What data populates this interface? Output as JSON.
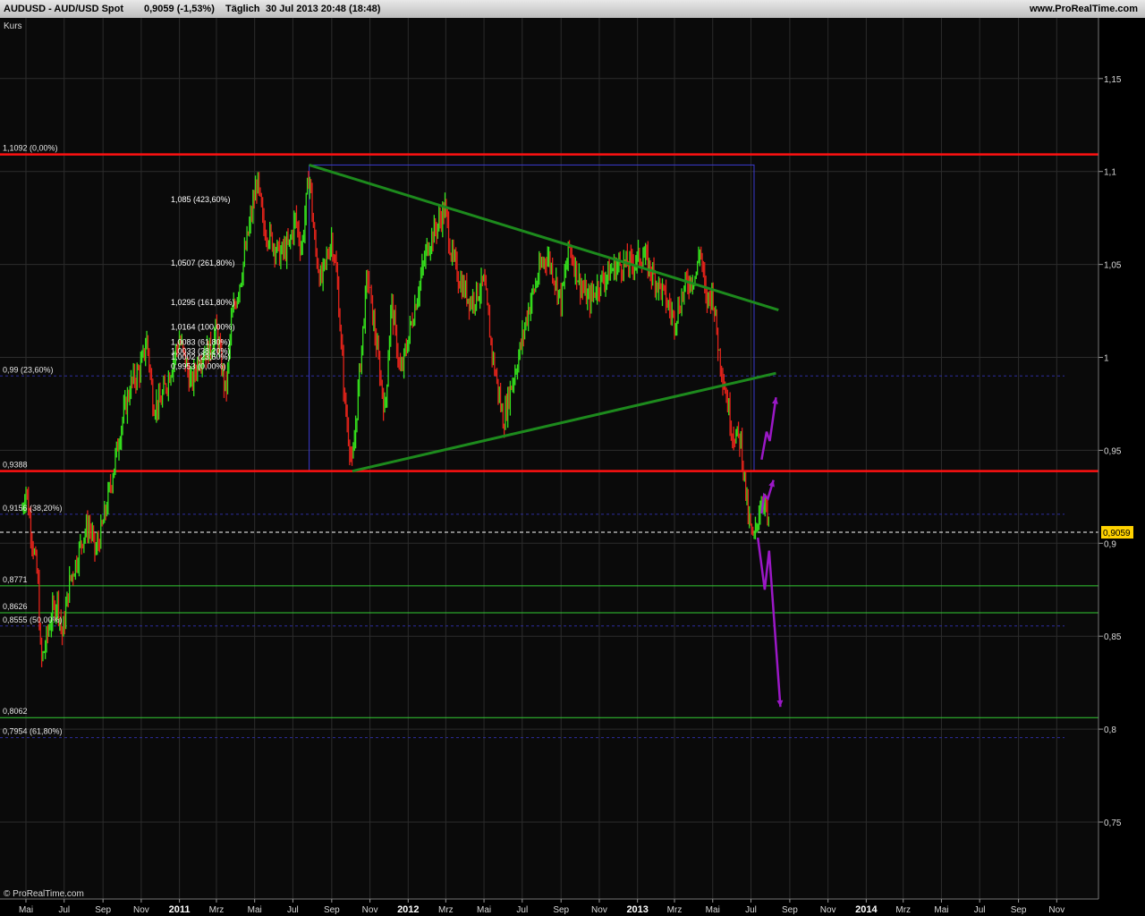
{
  "header": {
    "symbol": "AUDUSD - AUD/USD Spot",
    "quote": "0,9059 (-1,53%)",
    "period": "Täglich",
    "timestamp": "30 Jul 2013 20:48 (18:48)",
    "site": "www.ProRealTime.com"
  },
  "panel_label": "Kurs",
  "copyright": "© ProRealTime.com",
  "current_price_label": "0,9059",
  "colors": {
    "background": "#000000",
    "plot_bg": "#0a0a0a",
    "bull": "#34e01c",
    "bear": "#e2231a",
    "resistance": "#ff1111",
    "support_green": "#33cc33",
    "triangle": "#1d8a1d",
    "projection": "#9b18c6",
    "fib_blue": "#2d2d9f",
    "price_tag": "#ffd200"
  },
  "chart_data": {
    "type": "line",
    "title": "AUDUSD - AUD/USD Spot",
    "ylabel": "Kurs",
    "ylim": [
      0.7,
      1.19
    ],
    "grid": true,
    "x_tick_labels": [
      "Mai",
      "Jul",
      "Sep",
      "Nov",
      "2011",
      "Mrz",
      "Mai",
      "Jul",
      "Sep",
      "Nov",
      "2012",
      "Mrz",
      "Mai",
      "Jul",
      "Sep",
      "Nov",
      "2013",
      "Mrz",
      "Mai",
      "Jul",
      "Sep",
      "Nov",
      "2014",
      "Mrz",
      "Mai",
      "Jul",
      "Sep",
      "Nov"
    ],
    "x_tick_dates": [
      "2010-05",
      "2010-07",
      "2010-09",
      "2010-11",
      "2011-01",
      "2011-03",
      "2011-05",
      "2011-07",
      "2011-09",
      "2011-11",
      "2012-01",
      "2012-03",
      "2012-05",
      "2012-07",
      "2012-09",
      "2012-11",
      "2013-01",
      "2013-03",
      "2013-05",
      "2013-07",
      "2013-09",
      "2013-11",
      "2014-01",
      "2014-03",
      "2014-05",
      "2014-07",
      "2014-09",
      "2014-11"
    ],
    "y_ticks": [
      {
        "value": 1.15,
        "label": "1,15"
      },
      {
        "value": 1.1,
        "label": "1,1"
      },
      {
        "value": 1.05,
        "label": "1,05"
      },
      {
        "value": 1.0,
        "label": "1"
      },
      {
        "value": 0.95,
        "label": "0,95"
      },
      {
        "value": 0.9,
        "label": "0,9"
      },
      {
        "value": 0.85,
        "label": "0,85"
      },
      {
        "value": 0.8,
        "label": "0,8"
      },
      {
        "value": 0.75,
        "label": "0,75"
      }
    ],
    "price_path": [
      [
        "2010-04-25",
        0.918
      ],
      [
        "2010-05-01",
        0.93
      ],
      [
        "2010-05-10",
        0.905
      ],
      [
        "2010-05-20",
        0.88
      ],
      [
        "2010-05-25",
        0.835
      ],
      [
        "2010-06-01",
        0.845
      ],
      [
        "2010-06-10",
        0.86
      ],
      [
        "2010-06-20",
        0.87
      ],
      [
        "2010-06-28",
        0.85
      ],
      [
        "2010-07-10",
        0.88
      ],
      [
        "2010-07-20",
        0.89
      ],
      [
        "2010-08-01",
        0.905
      ],
      [
        "2010-08-10",
        0.91
      ],
      [
        "2010-08-20",
        0.895
      ],
      [
        "2010-09-01",
        0.91
      ],
      [
        "2010-09-15",
        0.935
      ],
      [
        "2010-10-01",
        0.965
      ],
      [
        "2010-10-15",
        0.985
      ],
      [
        "2010-11-01",
        0.995
      ],
      [
        "2010-11-10",
        1.01
      ],
      [
        "2010-11-20",
        0.975
      ],
      [
        "2010-12-01",
        0.975
      ],
      [
        "2010-12-15",
        0.99
      ],
      [
        "2011-01-01",
        1.01
      ],
      [
        "2011-01-20",
        0.985
      ],
      [
        "2011-02-01",
        1.0
      ],
      [
        "2011-02-20",
        1.005
      ],
      [
        "2011-03-01",
        1.015
      ],
      [
        "2011-03-16",
        0.98
      ],
      [
        "2011-03-25",
        1.02
      ],
      [
        "2011-04-10",
        1.045
      ],
      [
        "2011-04-30",
        1.085
      ],
      [
        "2011-05-05",
        1.095
      ],
      [
        "2011-05-15",
        1.07
      ],
      [
        "2011-05-25",
        1.065
      ],
      [
        "2011-06-10",
        1.055
      ],
      [
        "2011-06-25",
        1.06
      ],
      [
        "2011-07-05",
        1.075
      ],
      [
        "2011-07-15",
        1.058
      ],
      [
        "2011-07-27",
        1.1
      ],
      [
        "2011-08-05",
        1.06
      ],
      [
        "2011-08-15",
        1.04
      ],
      [
        "2011-09-01",
        1.065
      ],
      [
        "2011-09-10",
        1.04
      ],
      [
        "2011-09-22",
        0.975
      ],
      [
        "2011-10-04",
        0.94
      ],
      [
        "2011-10-15",
        0.99
      ],
      [
        "2011-10-28",
        1.045
      ],
      [
        "2011-11-10",
        1.01
      ],
      [
        "2011-11-25",
        0.97
      ],
      [
        "2011-12-05",
        1.03
      ],
      [
        "2011-12-20",
        0.99
      ],
      [
        "2012-01-10",
        1.025
      ],
      [
        "2012-02-01",
        1.06
      ],
      [
        "2012-02-29",
        1.08
      ],
      [
        "2012-03-10",
        1.055
      ],
      [
        "2012-03-25",
        1.04
      ],
      [
        "2012-04-10",
        1.03
      ],
      [
        "2012-05-01",
        1.04
      ],
      [
        "2012-05-15",
        1.0
      ],
      [
        "2012-06-01",
        0.965
      ],
      [
        "2012-06-10",
        0.98
      ],
      [
        "2012-06-25",
        1.0
      ],
      [
        "2012-07-10",
        1.025
      ],
      [
        "2012-08-01",
        1.05
      ],
      [
        "2012-08-10",
        1.055
      ],
      [
        "2012-08-20",
        1.045
      ],
      [
        "2012-09-01",
        1.03
      ],
      [
        "2012-09-14",
        1.06
      ],
      [
        "2012-10-01",
        1.04
      ],
      [
        "2012-10-15",
        1.03
      ],
      [
        "2012-11-01",
        1.04
      ],
      [
        "2012-11-15",
        1.045
      ],
      [
        "2012-12-01",
        1.05
      ],
      [
        "2012-12-20",
        1.05
      ],
      [
        "2013-01-10",
        1.055
      ],
      [
        "2013-01-25",
        1.045
      ],
      [
        "2013-02-10",
        1.035
      ],
      [
        "2013-03-01",
        1.02
      ],
      [
        "2013-03-20",
        1.04
      ],
      [
        "2013-04-05",
        1.045
      ],
      [
        "2013-04-11",
        1.06
      ],
      [
        "2013-04-20",
        1.03
      ],
      [
        "2013-05-01",
        1.035
      ],
      [
        "2013-05-10",
        1.005
      ],
      [
        "2013-05-20",
        0.985
      ],
      [
        "2013-06-01",
        0.96
      ],
      [
        "2013-06-15",
        0.955
      ],
      [
        "2013-06-26",
        0.915
      ],
      [
        "2013-07-05",
        0.9
      ],
      [
        "2013-07-15",
        0.92
      ],
      [
        "2013-07-22",
        0.925
      ],
      [
        "2013-07-30",
        0.9059
      ]
    ]
  },
  "price_levels": [
    {
      "value": 1.1092,
      "label": "1,1092 (0,00%)",
      "kind": "resistance"
    },
    {
      "value": 0.9388,
      "label": "0,9388",
      "kind": "resistance"
    },
    {
      "value": 0.9059,
      "label": "",
      "kind": "current"
    },
    {
      "value": 0.8771,
      "label": "0,8771",
      "kind": "support"
    },
    {
      "value": 0.8626,
      "label": "0,8626",
      "kind": "support"
    },
    {
      "value": 0.8062,
      "label": "0,8062",
      "kind": "support"
    }
  ],
  "fib_levels": [
    {
      "value": 0.99,
      "label": "0,99 (23,60%)"
    },
    {
      "value": 0.9156,
      "label": "0,9156 (38,20%)"
    },
    {
      "value": 0.8555,
      "label": "0,8555 (50,00%)"
    },
    {
      "value": 0.7954,
      "label": "0,7954 (61,80%)"
    }
  ],
  "fib_extension_labels": [
    {
      "value": 1.085,
      "label": "1,085 (423,60%)"
    },
    {
      "value": 1.0507,
      "label": "1,0507 (261,80%)"
    },
    {
      "value": 1.0295,
      "label": "1,0295 (161,80%)"
    },
    {
      "value": 1.0164,
      "label": "1,0164 (100,00%)"
    },
    {
      "value": 1.0083,
      "label": "1,0083 (61,80%)"
    },
    {
      "value": 1.0033,
      "label": "1,0033 (38,20%)"
    },
    {
      "value": 1.0002,
      "label": "1,0002 (23,60%)"
    },
    {
      "value": 0.9953,
      "label": "0,9953 (0,00%)"
    }
  ],
  "triangle": {
    "upper": [
      [
        "2011-07-27",
        1.1035
      ],
      [
        "2013-08-14",
        1.0255
      ]
    ],
    "lower": [
      [
        "2011-10-04",
        0.9388
      ],
      [
        "2013-08-10",
        0.9915
      ]
    ],
    "box": [
      [
        "2011-07-27",
        1.1035
      ],
      [
        "2013-07-06",
        0.9388
      ]
    ]
  },
  "projections": [
    {
      "name": "up-large",
      "points": [
        [
          "2013-07-18",
          0.945
        ],
        [
          "2013-07-26",
          0.96
        ],
        [
          "2013-07-31",
          0.955
        ],
        [
          "2013-08-10",
          0.9785
        ]
      ]
    },
    {
      "name": "up-small",
      "points": [
        [
          "2013-07-18",
          0.916
        ],
        [
          "2013-07-22",
          0.926
        ],
        [
          "2013-07-28",
          0.924
        ],
        [
          "2013-08-06",
          0.934
        ]
      ]
    },
    {
      "name": "down",
      "points": [
        [
          "2013-07-12",
          0.903
        ],
        [
          "2013-07-23",
          0.875
        ],
        [
          "2013-07-30",
          0.896
        ],
        [
          "2013-08-17",
          0.812
        ]
      ]
    }
  ]
}
